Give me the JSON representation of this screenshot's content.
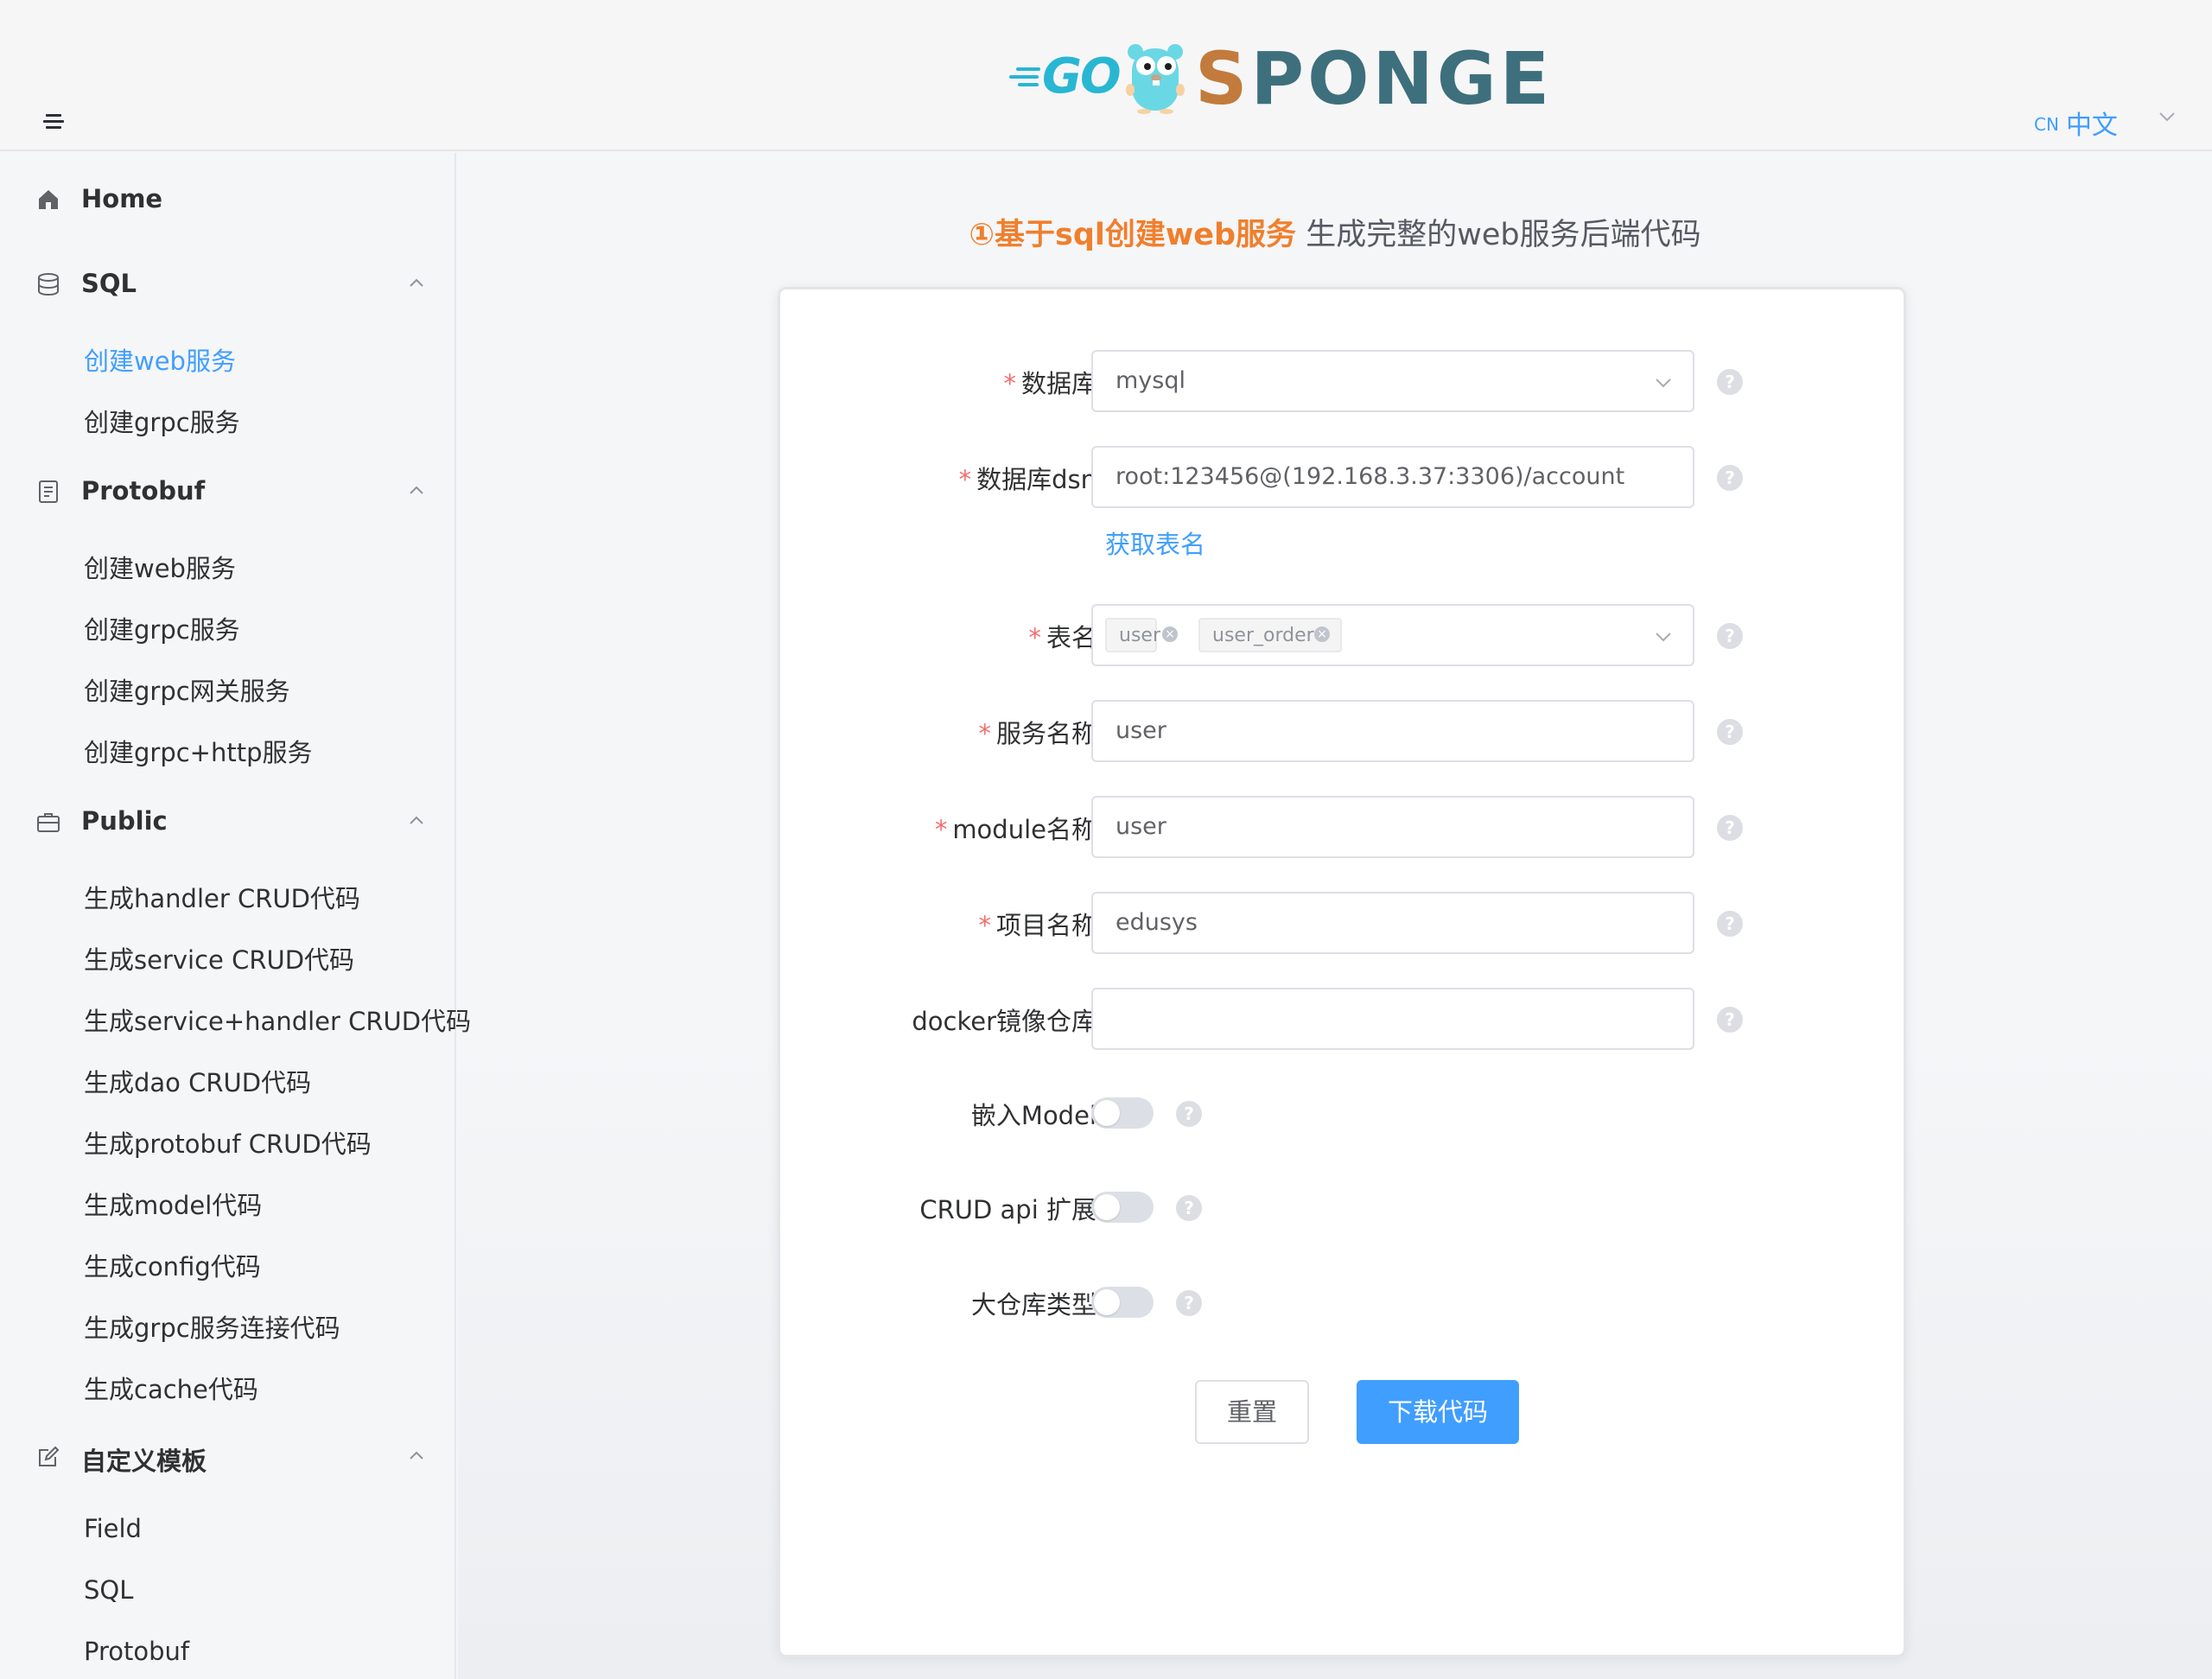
{
  "header": {
    "logo_go": "GO",
    "logo_text_first": "S",
    "logo_text_rest": "PONGE",
    "lang_code": "CN",
    "lang_label": "中文"
  },
  "sidebar": {
    "groups": [
      {
        "label": "Home",
        "icon": "home-icon"
      },
      {
        "label": "SQL",
        "icon": "database-icon",
        "items": [
          "创建web服务",
          "创建grpc服务"
        ]
      },
      {
        "label": "Protobuf",
        "icon": "document-icon",
        "items": [
          "创建web服务",
          "创建grpc服务",
          "创建grpc网关服务",
          "创建grpc+http服务"
        ]
      },
      {
        "label": "Public",
        "icon": "briefcase-icon",
        "items": [
          "生成handler CRUD代码",
          "生成service CRUD代码",
          "生成service+handler CRUD代码",
          "生成dao CRUD代码",
          "生成protobuf CRUD代码",
          "生成model代码",
          "生成config代码",
          "生成grpc服务连接代码",
          "生成cache代码"
        ]
      },
      {
        "label": "自定义模板",
        "icon": "edit-icon",
        "items": [
          "Field",
          "SQL",
          "Protobuf"
        ]
      }
    ],
    "active_item": "创建web服务"
  },
  "main": {
    "heading_highlight": "①基于sql创建web服务",
    "heading_rest": " 生成完整的web服务后端代码"
  },
  "form": {
    "database_label": "数据库",
    "database_value": "mysql",
    "dsn_label": "数据库dsn",
    "dsn_value": "root:123456@(192.168.3.37:3306)/account",
    "fetch_tables_link": "获取表名",
    "table_label": "表名",
    "table_tags": [
      "user",
      "user_order"
    ],
    "service_name_label": "服务名称",
    "service_name_value": "user",
    "module_name_label": "module名称",
    "module_name_value": "user",
    "project_name_label": "项目名称",
    "project_name_value": "edusys",
    "docker_repo_label": "docker镜像仓库",
    "docker_repo_value": "",
    "embed_model_label": "嵌入Model",
    "embed_model_on": false,
    "crud_api_label": "CRUD api 扩展",
    "crud_api_on": false,
    "monorepo_label": "大仓库类型",
    "monorepo_on": false,
    "help_glyph": "?",
    "tag_close_glyph": "×",
    "required_mark": "*",
    "reset_button": "重置",
    "download_button": "下载代码"
  },
  "colors": {
    "accent": "#409eff",
    "heading_highlight": "#f07f2d",
    "required": "#f56c6c"
  }
}
